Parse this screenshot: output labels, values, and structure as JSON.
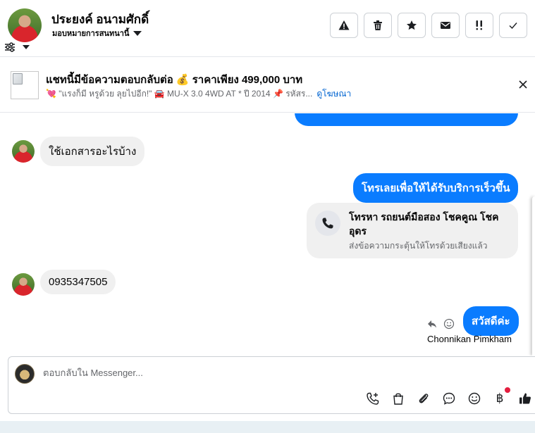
{
  "header": {
    "contact_name": "ประยงค์ อนามศักดิ์",
    "assign_label": "มอบหมายการสนทนานี้",
    "actions": [
      {
        "name": "report",
        "icon": "warning-icon"
      },
      {
        "name": "delete",
        "icon": "trash-icon"
      },
      {
        "name": "star",
        "icon": "star-icon"
      },
      {
        "name": "mail",
        "icon": "envelope-icon"
      },
      {
        "name": "follow-up",
        "icon": "double-exclamation-icon"
      },
      {
        "name": "done",
        "icon": "check-icon"
      }
    ]
  },
  "ad": {
    "title": "แชทนี้มีข้อความตอบกลับต่อ 💰 ราคาเพียง 499,000 บาท",
    "subtitle": "💘 \"แรงก็มี หรูด้วย ลุยไปอีก!\" 🚘 MU-X 3.0 4WD AT * ปี 2014 📌 รหัสร...",
    "link": "ดูโฆษณา"
  },
  "messages": {
    "in_1": "ใช้เอกสารอะไรบ้าง",
    "out_1": "โทรเลยเพื่อให้ได้รับบริการเร็วขึ้น",
    "call_title": "โทรหา รถยนต์มือสอง โชคคูณ โชค อุดร",
    "call_sub": "ส่งข้อความกระตุ้นให้โทรด้วยเสียงแล้ว",
    "in_2": "0935347505",
    "out_2": "สวัสดีค่ะ",
    "sender": "Chonnikan Pimkham"
  },
  "composer": {
    "placeholder": "ตอบกลับใน Messenger...",
    "baht_symbol": "฿"
  }
}
